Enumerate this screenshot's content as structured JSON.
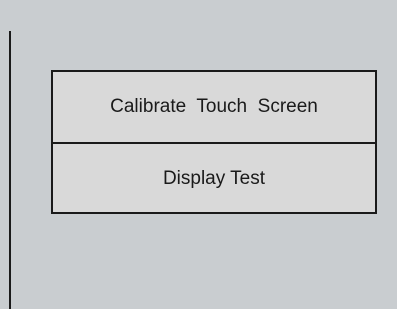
{
  "menu": {
    "items": [
      {
        "label": "Calibrate  Touch  Screen"
      },
      {
        "label": "Display Test"
      }
    ]
  }
}
